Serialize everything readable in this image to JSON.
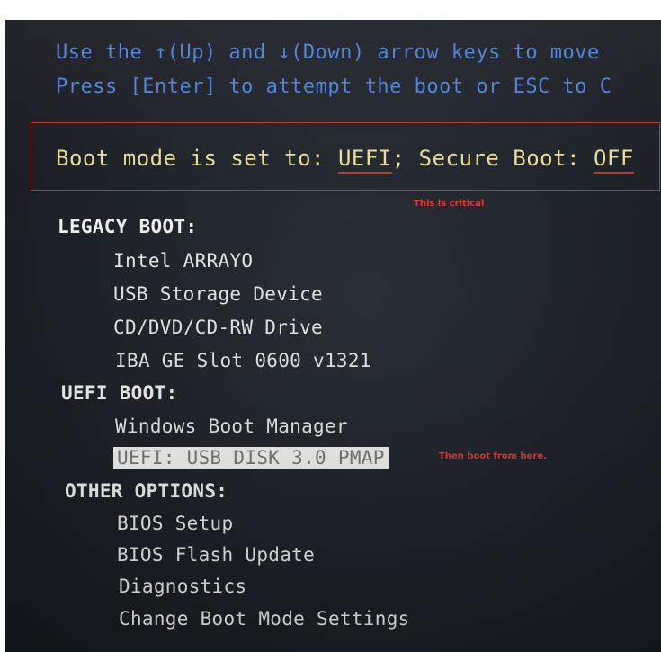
{
  "hints": {
    "line1": "Use the ↑(Up) and ↓(Down) arrow keys to move",
    "line2": "Press [Enter] to attempt the boot or ESC to C"
  },
  "boot_mode": {
    "prefix": "Boot mode is set to: ",
    "mode": "UEFI",
    "separator": "; Secure Boot: ",
    "secure_boot": "OFF"
  },
  "annotations": {
    "critical": "This is critical",
    "boot_here": "Then boot from here."
  },
  "sections": {
    "legacy": {
      "title": "LEGACY BOOT:",
      "items": [
        "Intel ARRAYO",
        "USB Storage Device",
        "CD/DVD/CD-RW Drive",
        "IBA GE Slot 0600 v1321"
      ]
    },
    "uefi": {
      "title": "UEFI BOOT:",
      "items": [
        "Windows Boot Manager",
        "UEFI:  USB DISK 3.0 PMAP"
      ]
    },
    "other": {
      "title": "OTHER OPTIONS:",
      "items": [
        "BIOS Setup",
        "BIOS Flash Update",
        "Diagnostics",
        "Change Boot Mode Settings"
      ]
    }
  },
  "selected_item": "UEFI:  USB DISK 3.0 PMAP",
  "colors": {
    "hint_text": "#4f7fd6",
    "boot_mode_text": "#e8dc9a",
    "annotation": "#e53935",
    "menu_text": "#e9e9e9",
    "selected_bg": "#f4f4f4"
  }
}
